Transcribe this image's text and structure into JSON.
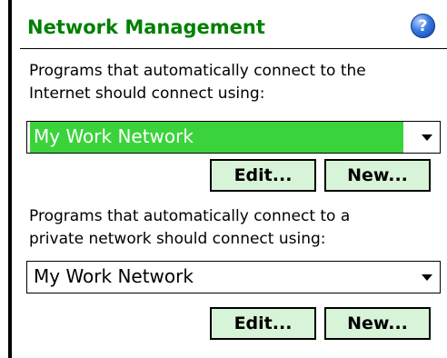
{
  "header": {
    "title": "Network Management",
    "help_glyph": "?"
  },
  "internet": {
    "label_line1": "Programs that automatically connect to the",
    "label_line2": "Internet should connect using:",
    "selected": "My Work Network",
    "edit_label": "Edit...",
    "new_label": "New..."
  },
  "private": {
    "label_line1": "Programs that automatically connect to a",
    "label_line2": "private network should connect using:",
    "selected": "My Work Network",
    "edit_label": "Edit...",
    "new_label": "New..."
  },
  "colors": {
    "title": "#008000",
    "selection": "#3bd33b",
    "button_bg": "#d8f4d8"
  }
}
